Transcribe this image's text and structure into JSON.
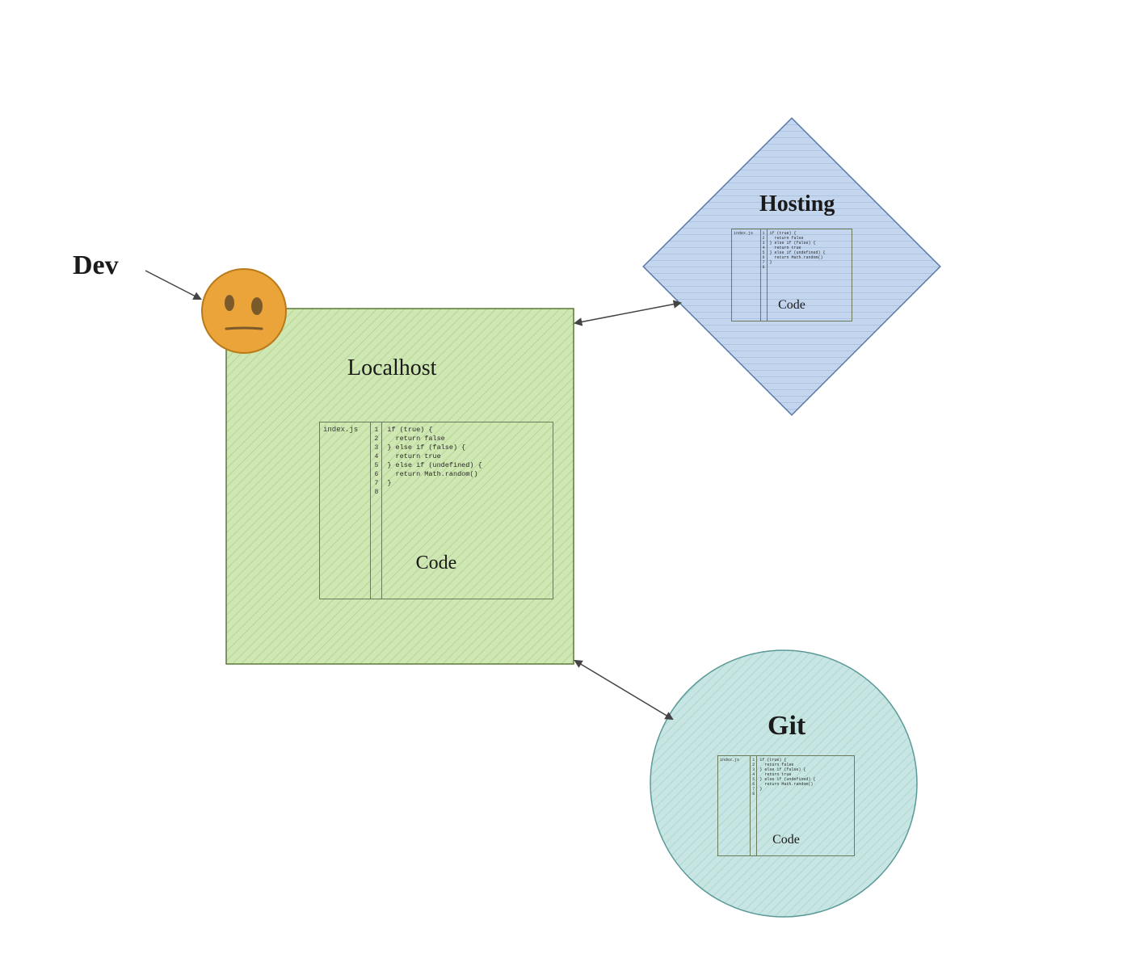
{
  "labels": {
    "dev": "Dev",
    "localhost": "Localhost",
    "hosting": "Hosting",
    "git": "Git"
  },
  "codecard": {
    "filename": "index.js",
    "caption": "Code",
    "line_numbers": "1\n2\n3\n4\n5\n6\n7\n8",
    "code": "if (true) {\n  return false\n} else if (false) {\n  return true\n} else if (undefined) {\n  return Math.random()\n}\n"
  },
  "colors": {
    "green": "#c8e2a8",
    "blue": "#b8cce8",
    "teal": "#bde0dd",
    "face": "#eaa43a"
  }
}
